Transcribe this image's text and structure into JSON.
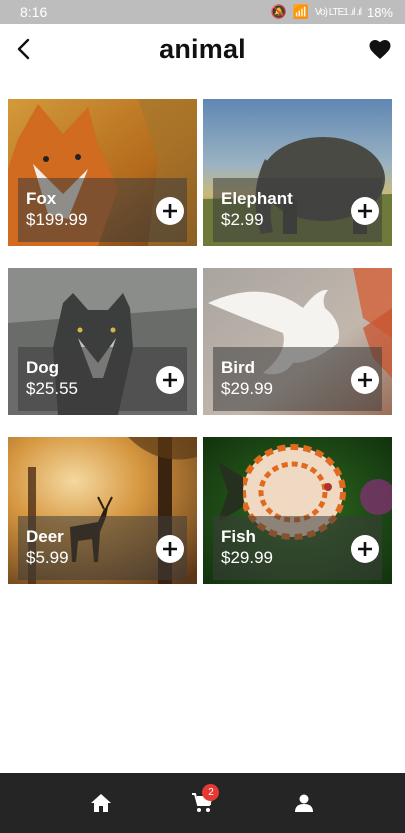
{
  "status_bar": {
    "time": "8:16",
    "signal": "Vo) LTE1 .ıl .ıl",
    "battery": "18%"
  },
  "app_bar": {
    "title": "animal"
  },
  "products": [
    {
      "name": "Fox",
      "price": "$199.99",
      "icon": "fox-photo"
    },
    {
      "name": "Elephant",
      "price": "$2.99",
      "icon": "elephant-photo"
    },
    {
      "name": "Dog",
      "price": "$25.55",
      "icon": "wolf-photo"
    },
    {
      "name": "Bird",
      "price": "$29.99",
      "icon": "dove-photo"
    },
    {
      "name": "Deer",
      "price": "$5.99",
      "icon": "deer-photo"
    },
    {
      "name": "Fish",
      "price": "$29.99",
      "icon": "fish-photo"
    }
  ],
  "bottom_nav": {
    "cart_count": "2",
    "items": [
      "home-icon",
      "cart-icon",
      "account-icon"
    ]
  },
  "colors": {
    "nav_bg": "#252525",
    "badge": "#e53935",
    "status_bg": "#bdbdbd"
  }
}
